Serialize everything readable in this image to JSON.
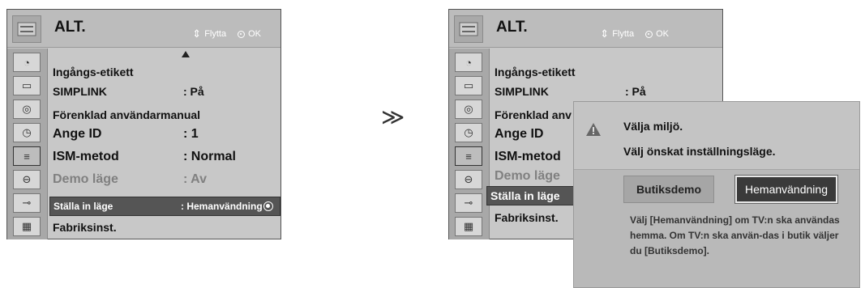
{
  "panel_left": {
    "title": "ALT.",
    "hint_move": "Flytta",
    "hint_ok": "OK",
    "items": [
      {
        "label": "Ingångs-etikett",
        "value": ""
      },
      {
        "label": "SIMPLINK",
        "value": ": På"
      },
      {
        "label": "Förenklad användarmanual",
        "value": ""
      },
      {
        "label": "Ange ID",
        "value": ": 1"
      },
      {
        "label": "ISM-metod",
        "value": ": Normal"
      },
      {
        "label": "Demo läge",
        "value": ": Av"
      },
      {
        "label": "Ställa in läge",
        "value": ": Hemanvändning"
      },
      {
        "label": "Fabriksinst.",
        "value": ""
      }
    ]
  },
  "panel_right": {
    "title": "ALT.",
    "hint_move": "Flytta",
    "hint_ok": "OK",
    "items": [
      {
        "label": "Ingångs-etikett",
        "value": ""
      },
      {
        "label": "SIMPLINK",
        "value": ": På"
      },
      {
        "label": "Förenklad anv",
        "value": ""
      },
      {
        "label": "Ange ID",
        "value": ""
      },
      {
        "label": "ISM-metod",
        "value": ""
      },
      {
        "label": "Demo läge",
        "value": ""
      },
      {
        "label": "Ställa in läge",
        "value": ""
      },
      {
        "label": "Fabriksinst.",
        "value": ""
      }
    ]
  },
  "separator": "≫",
  "dialog": {
    "title": "Välja miljö.",
    "subtitle": "Välj önskat inställningsläge.",
    "button_shop": "Butiksdemo",
    "button_home": "Hemanvändning",
    "description": "Välj [Hemanvändning] om TV:n ska användas hemma. Om TV:n ska använ-das i butik väljer du [Butiksdemo]."
  },
  "side_icons": [
    "satellite-dish-icon",
    "monitor-icon",
    "speaker-icon",
    "clock-icon",
    "option-icon",
    "lock-icon",
    "input-plug-icon",
    "usb-media-icon"
  ]
}
